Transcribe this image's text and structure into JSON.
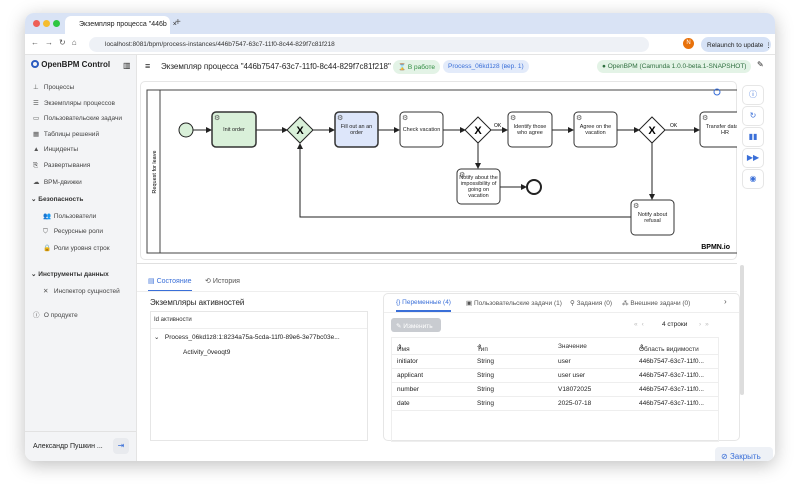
{
  "browser": {
    "tab_title": "Экземпляр процесса \"446b",
    "url": "localhost:8081/bpm/process-instances/446b7547-63c7-11f0-8c44-829f7c81f218",
    "relaunch_label": "Relaunch to update",
    "profile_initial": "N"
  },
  "sidebar": {
    "brand": "OpenBPM Control",
    "items": [
      {
        "label": "Процессы",
        "icon": "sitemap-icon"
      },
      {
        "label": "Экземпляры процессов",
        "icon": "list-icon"
      },
      {
        "label": "Пользовательские задачи",
        "icon": "task-icon"
      },
      {
        "label": "Таблицы решений",
        "icon": "table-icon"
      },
      {
        "label": "Инциденты",
        "icon": "warning-icon"
      },
      {
        "label": "Развертывания",
        "icon": "deploy-icon"
      },
      {
        "label": "BPM-движки",
        "icon": "cloud-icon"
      }
    ],
    "security": {
      "label": "Безопасность",
      "items": [
        {
          "label": "Пользователи"
        },
        {
          "label": "Ресурсные роли"
        },
        {
          "label": "Роли уровня строк"
        }
      ]
    },
    "data_tools": {
      "label": "Инструменты данных",
      "items": [
        {
          "label": "Инспектор сущностей"
        }
      ]
    },
    "about": "О продукте",
    "user": "Александр Пушкин ..."
  },
  "header": {
    "title": "Экземпляр процесса \"446b7547-63c7-11f0-8c44-829f7c81f218\"",
    "status": "В работе",
    "process": "Process_06kd1z8 (вер. 1)",
    "engine": "OpenBPM (Camunda 1.0.0-beta.1-SNAPSHOT)"
  },
  "diagram": {
    "lane": "Request for leave",
    "watermark": "BPMN.io",
    "tasks": {
      "init": "Init order",
      "fill": "Fill out an an order",
      "check": "Check vacation",
      "identify": "Identify those who agree",
      "agree": "Agree on the vacation",
      "transfer": "Transfer data to HR",
      "impossible": "Notify about the impossibility of going on vacation",
      "refusal": "Notify about refusal"
    },
    "flow_ok": "OK"
  },
  "tabs": {
    "state": "Состояние",
    "history": "История"
  },
  "activities": {
    "title": "Экземпляры активностей",
    "column": "Id активности",
    "root": "Process_06kd1z8:1:8234a75a-5cda-11f0-89e6-3e77bc03e...",
    "child": "Activity_0veoqt9"
  },
  "vars": {
    "tabs": [
      "Переменные (4)",
      "Пользовательские задачи (1)",
      "Задания (0)",
      "Внешние задачи (0)"
    ],
    "edit": "Изменить",
    "rows_count": "4 строки",
    "columns": [
      "Имя",
      "Тип",
      "Значение",
      "Область видимости"
    ],
    "rows": [
      [
        "initiator",
        "String",
        "user",
        "446b7547-63c7-11f0..."
      ],
      [
        "applicant",
        "String",
        "user user",
        "446b7547-63c7-11f0..."
      ],
      [
        "number",
        "String",
        "V18072025",
        "446b7547-63c7-11f0..."
      ],
      [
        "date",
        "String",
        "2025-07-18",
        "446b7547-63c7-11f0..."
      ]
    ]
  },
  "close": "Закрыть"
}
